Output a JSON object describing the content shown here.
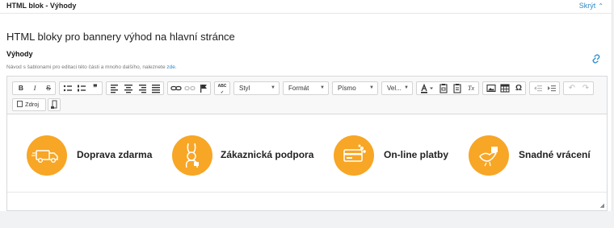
{
  "header": {
    "title": "HTML blok - Výhody",
    "toggle_label": "Skrýt"
  },
  "page_title": "HTML bloky pro bannery výhod na hlavní stránce",
  "field": {
    "label": "Výhody",
    "help_text": "Návod s šablonami pro editaci této části a mnoho dalšího, naleznete",
    "help_link": "zde",
    "help_end": "."
  },
  "toolbar": {
    "buttons": {
      "bold": "B",
      "italic": "I",
      "strike": "S",
      "blockquote": "❞",
      "remove_format": "Tx",
      "special_char": "Ω",
      "spellcheck": "ABC"
    },
    "dropdowns": {
      "styl": "Styl",
      "format": "Formát",
      "pismo": "Písmo",
      "velikost": "Vel..."
    },
    "source_label": "Zdroj"
  },
  "benefits": [
    {
      "label": "Doprava zdarma",
      "icon": "truck-icon"
    },
    {
      "label": "Zákaznická podpora",
      "icon": "support-bunny-icon"
    },
    {
      "label": "On-line platby",
      "icon": "credit-card-icon"
    },
    {
      "label": "Snadné vrácení",
      "icon": "return-bird-icon"
    }
  ],
  "colors": {
    "accent": "#f7a626",
    "link": "#2b8bc6"
  }
}
